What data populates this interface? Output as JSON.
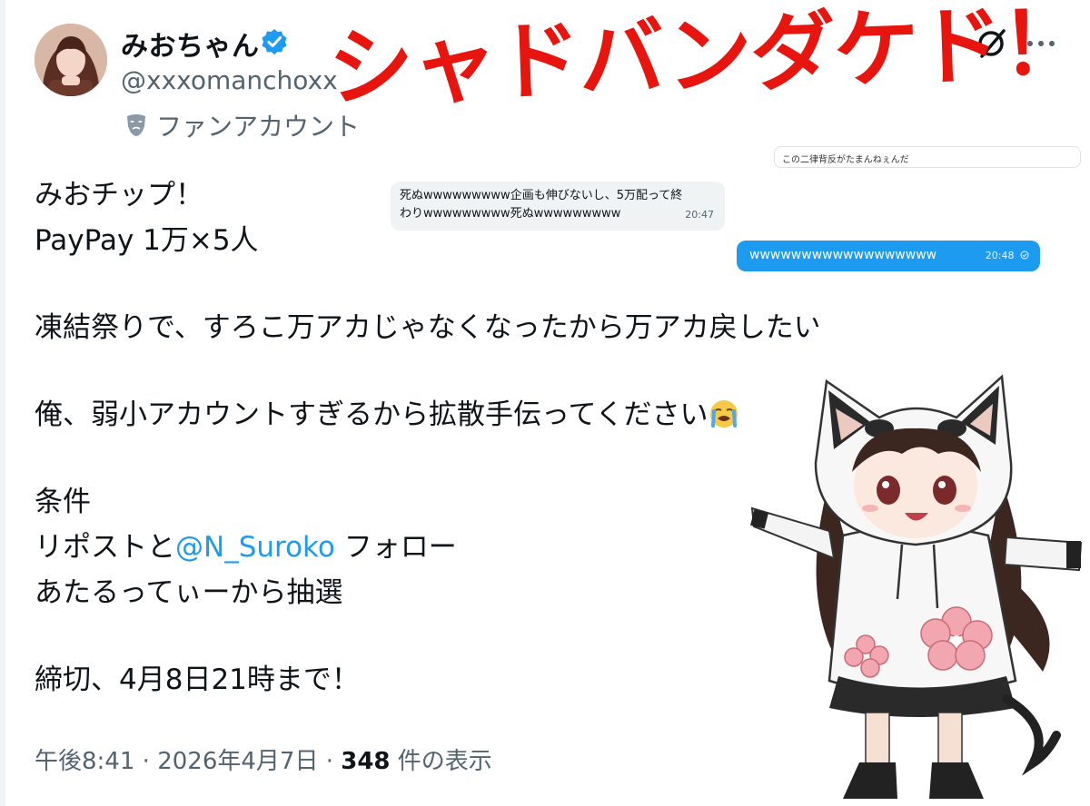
{
  "post": {
    "display_name": "みおちゃん",
    "handle": "@xxxomanchoxxx",
    "account_label": "ファンアカウント",
    "body": {
      "line1": "みおチップ！",
      "line2": "PayPay 1万×5人",
      "line3": "凍結祭りで、すろこ万アカじゃなくなったから万アカ戻したい。",
      "line4": "俺、弱小アカウントすぎるから拡散手伝ってください",
      "line5": "条件",
      "line6_prefix": "リポストと",
      "line6_mention": "@N_Suroko",
      "line6_suffix": " フォロー",
      "line7": "あたるってぃーから抽選",
      "line8": "締切、4月8日21時まで！"
    },
    "meta": {
      "time": "午後8:41",
      "sep1": " · ",
      "date": "2026年4月7日",
      "sep2": " · ",
      "views": "348",
      "views_suffix": " 件の表示"
    }
  },
  "overlay": {
    "title": "シャドバンダケド！",
    "color": "#e8150f"
  },
  "dm": {
    "small_snippet": "この二律背反がたまんねぇんだ",
    "received": {
      "line1": "死ぬwwwwwwwww企画も伸びないし、5万配って終",
      "line2": "わりwwwwwwwww死ぬwwwwwwwww",
      "time": "20:47"
    },
    "sent": {
      "text": "wwwwwwwwwwwwwwwwww",
      "time": "20:48"
    }
  },
  "icons": {
    "verified": "verified-badge-icon",
    "grok": "grok-icon",
    "more": "more-options-icon",
    "mask": "fan-mask-icon",
    "emoji": "loudly-crying-face-emoji",
    "accent": "#1d9bf0"
  }
}
